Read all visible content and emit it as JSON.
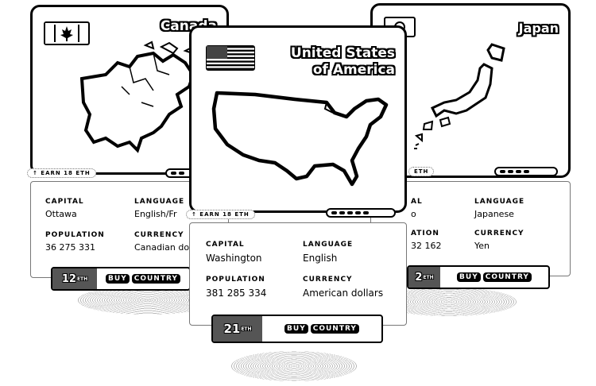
{
  "cards": {
    "canada": {
      "title": "Canada",
      "flag_icon": "canada-flag-icon",
      "earn": "↑ EARN 18 ETH",
      "capital_label": "CAPITAL",
      "capital": "Ottawa",
      "language_label": "LANGUAGE",
      "language": "English/Fr",
      "population_label": "POPULATION",
      "population": "36 275 331",
      "currency_label": "CURRENCY",
      "currency": "Canadian do",
      "price": "12",
      "price_unit": "ETH",
      "buy": "BUY",
      "country": "COUNTRY"
    },
    "usa": {
      "title_line1": "United States",
      "title_line2": "of America",
      "flag_icon": "usa-flag-icon",
      "earn": "↑ EARN 18 ETH",
      "capital_label": "CAPITAL",
      "capital": "Washington",
      "language_label": "LANGUAGE",
      "language": "English",
      "population_label": "POPULATION",
      "population": "381 285 334",
      "currency_label": "CURRENCY",
      "currency": "American dollars",
      "price": "21",
      "price_unit": "ETH",
      "buy": "BUY",
      "country": "COUNTRY"
    },
    "japan": {
      "title": "Japan",
      "flag_icon": "japan-flag-icon",
      "earn": "ETH",
      "capital_label": "AL",
      "capital": "o",
      "language_label": "LANGUAGE",
      "language": "Japanese",
      "population_label": "ATION",
      "population": "32 162",
      "currency_label": "CURRENCY",
      "currency": "Yen",
      "price": "2",
      "price_unit": "ETH",
      "buy": "BUY",
      "country": "COUNTRY"
    }
  }
}
